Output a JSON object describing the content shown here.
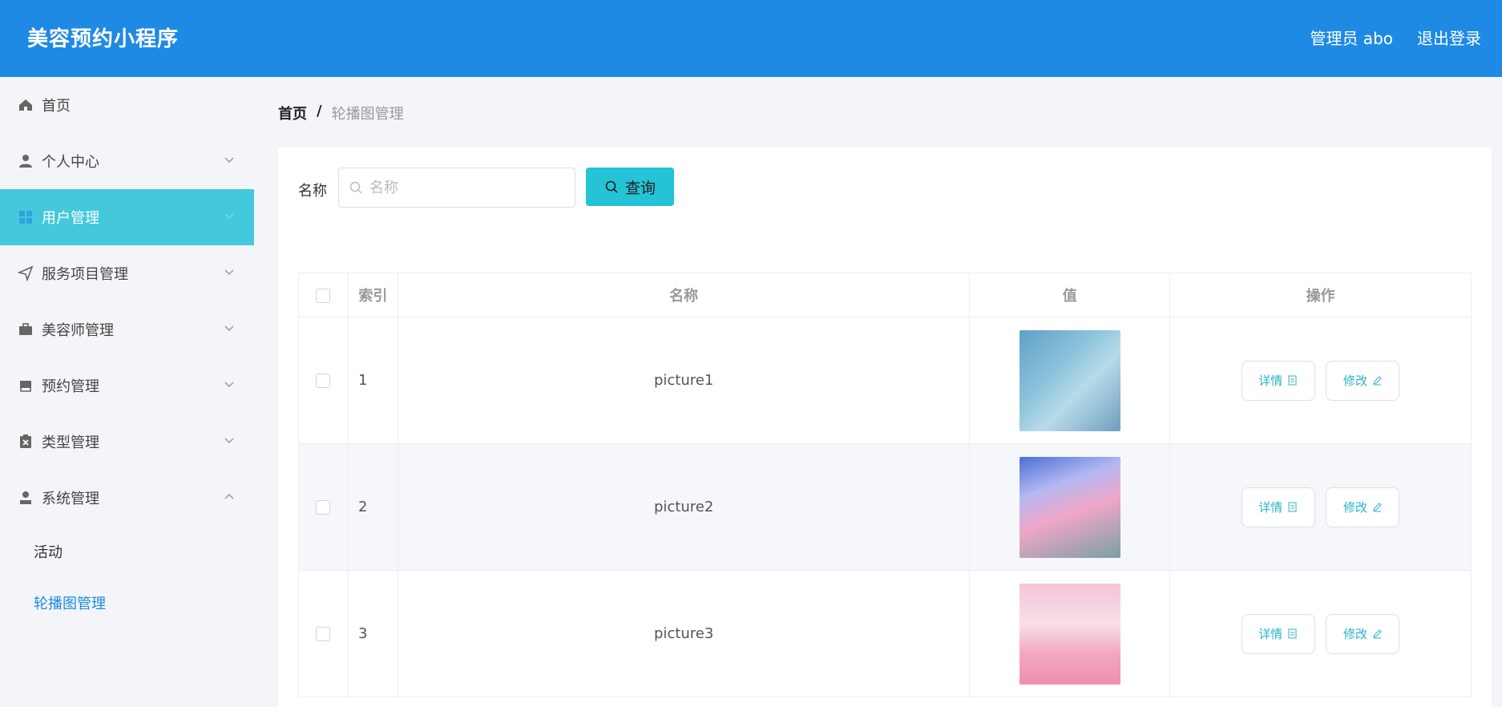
{
  "header": {
    "title": "美容预约小程序",
    "user": "管理员 abo",
    "logout": "退出登录"
  },
  "sidebar": {
    "items": [
      {
        "label": "首页",
        "icon": "home-icon",
        "expandable": false
      },
      {
        "label": "个人中心",
        "icon": "user-icon",
        "expandable": true
      },
      {
        "label": "用户管理",
        "icon": "grid-icon",
        "expandable": true,
        "active": true
      },
      {
        "label": "服务项目管理",
        "icon": "send-icon",
        "expandable": true
      },
      {
        "label": "美容师管理",
        "icon": "briefcase-icon",
        "expandable": true
      },
      {
        "label": "预约管理",
        "icon": "inbox-icon",
        "expandable": true
      },
      {
        "label": "类型管理",
        "icon": "clipboard-icon",
        "expandable": true
      },
      {
        "label": "系统管理",
        "icon": "user-stamp-icon",
        "expandable": true,
        "expanded": true
      }
    ],
    "sub_items": [
      {
        "label": "活动"
      },
      {
        "label": "轮播图管理",
        "active": true
      }
    ]
  },
  "breadcrumb": {
    "home": "首页",
    "separator": "/",
    "current": "轮播图管理"
  },
  "search": {
    "label": "名称",
    "placeholder": "名称",
    "button": "查询"
  },
  "table": {
    "headers": {
      "index": "索引",
      "name": "名称",
      "value": "值",
      "action": "操作"
    },
    "rows": [
      {
        "index": "1",
        "name": "picture1"
      },
      {
        "index": "2",
        "name": "picture2"
      },
      {
        "index": "3",
        "name": "picture3"
      }
    ],
    "detail_label": "详情",
    "edit_label": "修改"
  },
  "colors": {
    "header": "#1f8ae3",
    "active_menu": "#44c8dc",
    "search_button": "#24c3d6"
  }
}
